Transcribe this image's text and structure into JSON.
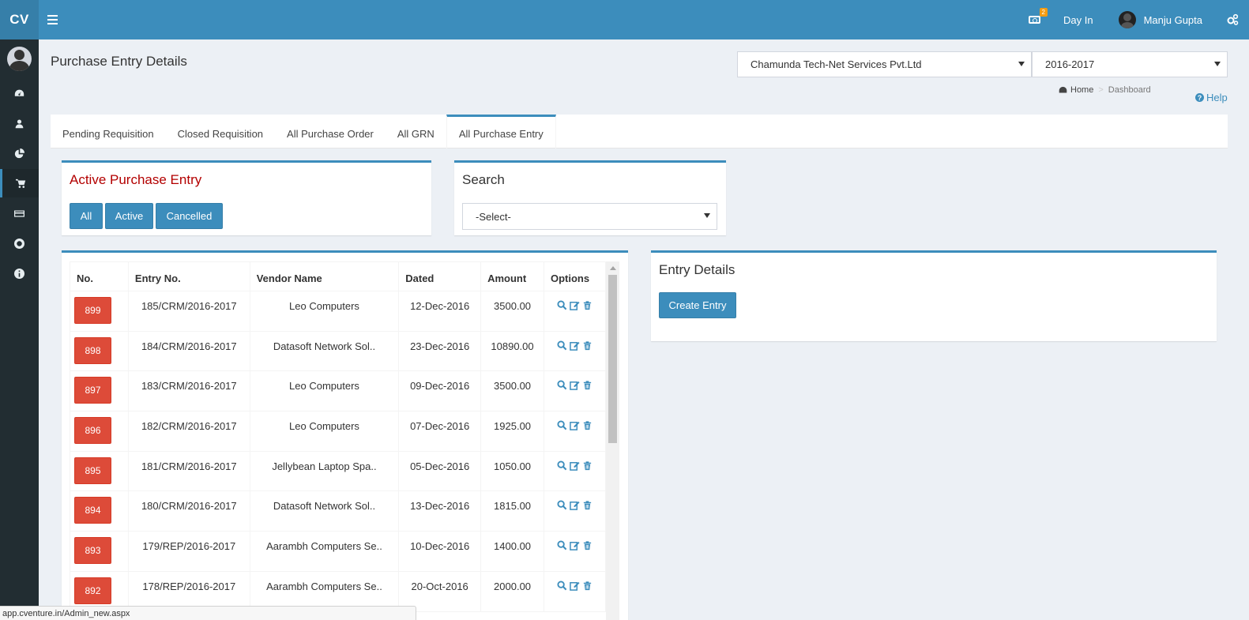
{
  "app": {
    "logo": "CV"
  },
  "topbar": {
    "notification_count": "2",
    "day_in": "Day In",
    "user_name": "Manju Gupta"
  },
  "page": {
    "title": "Purchase Entry Details"
  },
  "company_select": {
    "value": "Chamunda Tech-Net Services Pvt.Ltd"
  },
  "year_select": {
    "value": "2016-2017"
  },
  "breadcrumb": {
    "home": "Home",
    "current": "Dashboard"
  },
  "help": "Help",
  "tabs": [
    {
      "label": "Pending Requisition"
    },
    {
      "label": "Closed Requisition"
    },
    {
      "label": "All Purchase Order"
    },
    {
      "label": "All GRN"
    },
    {
      "label": "All Purchase Entry"
    }
  ],
  "active_box": {
    "title": "Active Purchase Entry",
    "buttons": {
      "all": "All",
      "active": "Active",
      "cancelled": "Cancelled"
    }
  },
  "search_box": {
    "title": "Search",
    "select_value": "-Select-"
  },
  "entry_details": {
    "title": "Entry Details",
    "create_button": "Create Entry"
  },
  "table": {
    "headers": {
      "no": "No.",
      "entry_no": "Entry No.",
      "vendor": "Vendor Name",
      "dated": "Dated",
      "amount": "Amount",
      "options": "Options"
    },
    "rows": [
      {
        "no": "899",
        "entry_no": "185/CRM/2016-2017",
        "vendor": "Leo Computers",
        "dated": "12-Dec-2016",
        "amount": "3500.00"
      },
      {
        "no": "898",
        "entry_no": "184/CRM/2016-2017",
        "vendor": "Datasoft Network Sol..",
        "dated": "23-Dec-2016",
        "amount": "10890.00"
      },
      {
        "no": "897",
        "entry_no": "183/CRM/2016-2017",
        "vendor": "Leo Computers",
        "dated": "09-Dec-2016",
        "amount": "3500.00"
      },
      {
        "no": "896",
        "entry_no": "182/CRM/2016-2017",
        "vendor": "Leo Computers",
        "dated": "07-Dec-2016",
        "amount": "1925.00"
      },
      {
        "no": "895",
        "entry_no": "181/CRM/2016-2017",
        "vendor": "Jellybean Laptop Spa..",
        "dated": "05-Dec-2016",
        "amount": "1050.00"
      },
      {
        "no": "894",
        "entry_no": "180/CRM/2016-2017",
        "vendor": "Datasoft Network Sol..",
        "dated": "13-Dec-2016",
        "amount": "1815.00"
      },
      {
        "no": "893",
        "entry_no": "179/REP/2016-2017",
        "vendor": "Aarambh Computers Se..",
        "dated": "10-Dec-2016",
        "amount": "1400.00"
      },
      {
        "no": "892",
        "entry_no": "178/REP/2016-2017",
        "vendor": "Aarambh Computers Se..",
        "dated": "20-Oct-2016",
        "amount": "2000.00"
      }
    ]
  },
  "status_url": "app.cventure.in/Admin_new.aspx",
  "colors": {
    "primary": "#3c8dbc",
    "sidebar": "#222d32",
    "danger": "#dd4b39",
    "background": "#ecf0f5"
  }
}
